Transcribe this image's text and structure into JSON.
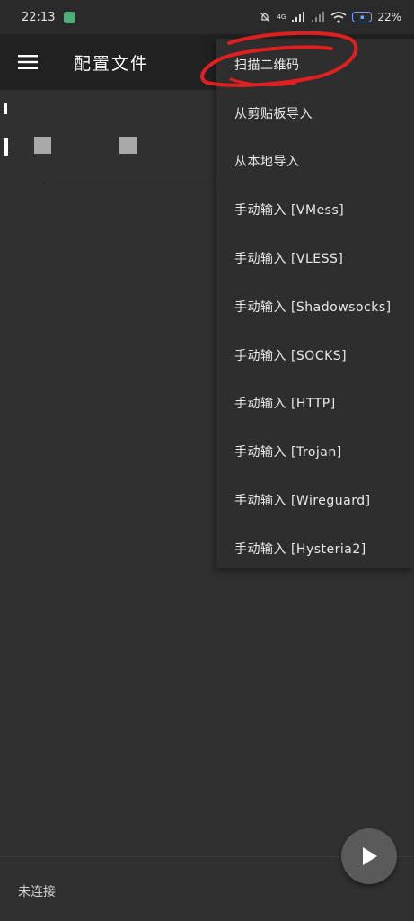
{
  "status_bar": {
    "time": "22:13",
    "battery": "22%",
    "signal_label": "4G"
  },
  "toolbar": {
    "title": "配置文件",
    "menu_icon": "hamburger-icon"
  },
  "dropdown": {
    "items": [
      "扫描二维码",
      "从剪贴板导入",
      "从本地导入",
      "手动输入 [VMess]",
      "手动输入 [VLESS]",
      "手动输入 [Shadowsocks]",
      "手动输入 [SOCKS]",
      "手动输入 [HTTP]",
      "手动输入 [Trojan]",
      "手动输入 [Wireguard]",
      "手动输入 [Hysteria2]"
    ]
  },
  "bottom": {
    "connection_status": "未连接",
    "fab_icon": "play-icon"
  },
  "colors": {
    "background": "#303030",
    "toolbar": "#212121",
    "menu": "#2e2e2e",
    "annotation": "#e02020"
  }
}
